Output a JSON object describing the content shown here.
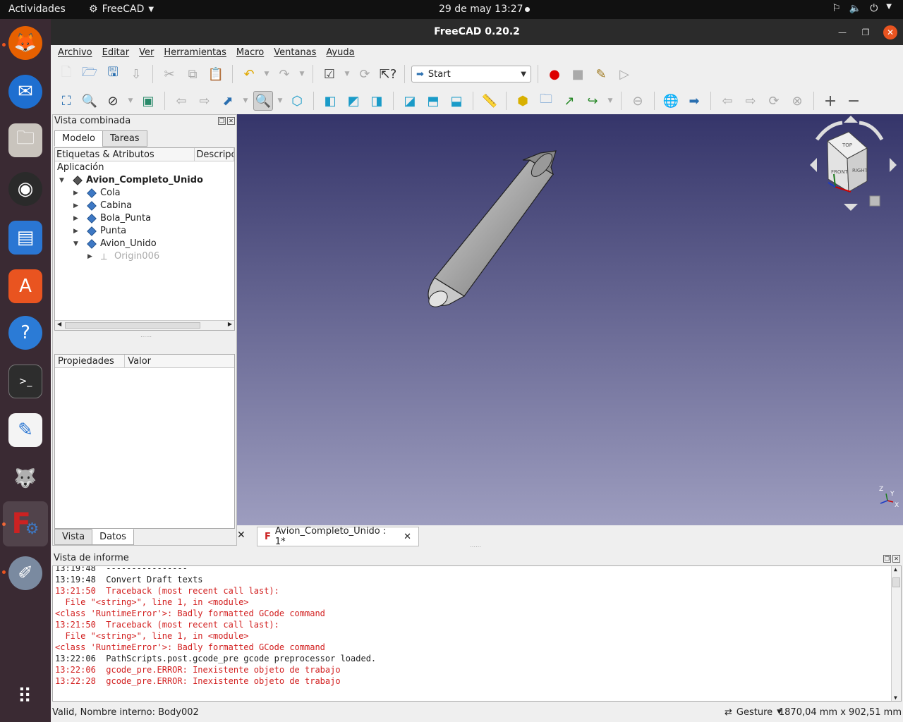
{
  "topbar": {
    "activities": "Actividades",
    "app_name": "FreeCAD",
    "clock": "29 de may  13:27"
  },
  "dock": {
    "items": [
      "firefox-icon",
      "thunderbird-icon",
      "files-icon",
      "rhythmbox-icon",
      "writer-icon",
      "app-center-icon",
      "help-icon",
      "terminal-icon",
      "text-editor-icon",
      "gimp-icon",
      "freecad-icon",
      "other-app-icon",
      "show-apps-icon"
    ]
  },
  "window": {
    "title": "FreeCAD 0.20.2"
  },
  "menu": [
    "Archivo",
    "Editar",
    "Ver",
    "Herramientas",
    "Macro",
    "Ventanas",
    "Ayuda"
  ],
  "toolbar": {
    "workbench": "Start"
  },
  "combo": {
    "title": "Vista combinada",
    "tabs": [
      "Modelo",
      "Tareas"
    ],
    "tree_columns": [
      "Etiquetas & Atributos",
      "Descripc"
    ],
    "section_label": "Aplicación",
    "tree": [
      {
        "label": "Avion_Completo_Unido",
        "bold": true
      },
      {
        "label": "Cola"
      },
      {
        "label": "Cabina"
      },
      {
        "label": "Bola_Punta"
      },
      {
        "label": "Punta"
      },
      {
        "label": "Avion_Unido"
      },
      {
        "label": "Origin006",
        "muted": true
      }
    ],
    "prop_columns": [
      "Propiedades",
      "Valor"
    ],
    "bottom_tabs": [
      "Vista",
      "Datos"
    ]
  },
  "viewport": {
    "navcube_faces": [
      "TOP",
      "FRONT",
      "RIGHT"
    ],
    "axis_labels": [
      "Z",
      "Y",
      "X"
    ],
    "doc_tab": "Avion_Completo_Unido : 1*"
  },
  "report": {
    "title": "Vista de informe",
    "lines": [
      {
        "text": "13:19:48  ----------------",
        "error": false
      },
      {
        "text": "13:19:48  Convert Draft texts",
        "error": false
      },
      {
        "text": "13:21:50  Traceback (most recent call last):",
        "error": true
      },
      {
        "text": "  File \"<string>\", line 1, in <module>",
        "error": true
      },
      {
        "text": "<class 'RuntimeError'>: Badly formatted GCode command",
        "error": true
      },
      {
        "text": "13:21:50  Traceback (most recent call last):",
        "error": true
      },
      {
        "text": "  File \"<string>\", line 1, in <module>",
        "error": true
      },
      {
        "text": "<class 'RuntimeError'>: Badly formatted GCode command",
        "error": true
      },
      {
        "text": "13:22:06  PathScripts.post.gcode_pre gcode preprocessor loaded.",
        "error": false
      },
      {
        "text": "13:22:06  gcode_pre.ERROR: Inexistente objeto de trabajo",
        "error": true
      },
      {
        "text": "13:22:28  gcode_pre.ERROR: Inexistente objeto de trabajo",
        "error": true
      }
    ]
  },
  "status": {
    "message": "Valid, Nombre interno: Body002",
    "nav_style": "Gesture",
    "dimensions": "1870,04 mm x 902,51 mm"
  },
  "colors": {
    "accent": "#e95420",
    "error_text": "#d21f1f",
    "viewport_top": "#35356a",
    "viewport_bottom": "#9d9dbf"
  }
}
